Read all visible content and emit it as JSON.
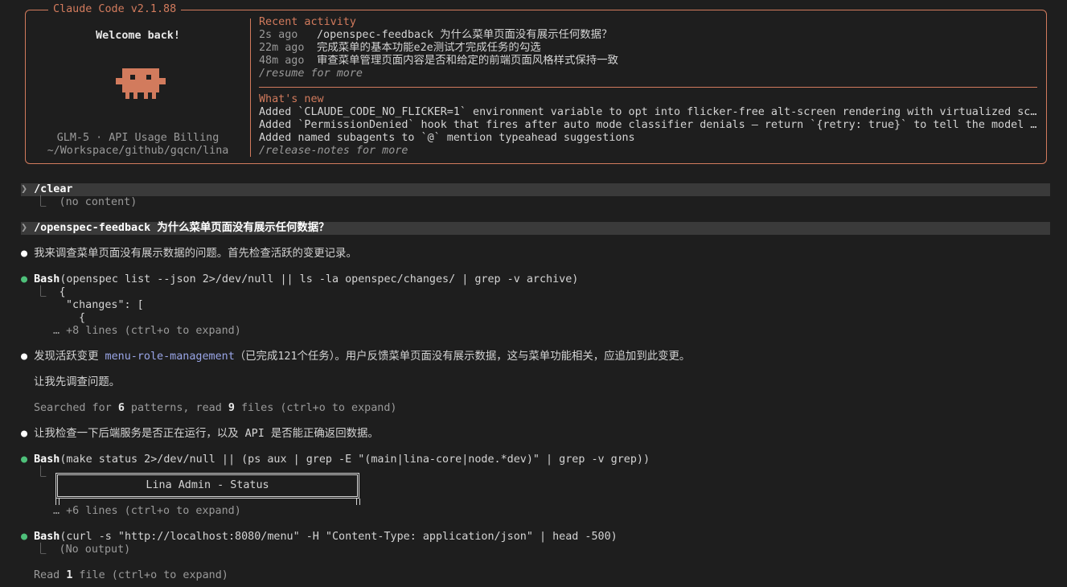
{
  "header": {
    "title": "Claude Code v2.1.88",
    "welcome": "Welcome back!",
    "model_line": "GLM-5 · API Usage Billing",
    "cwd": "~/Workspace/github/gqcn/lina",
    "recent_activity_title": "Recent activity",
    "recent": [
      {
        "time": "2s ago",
        "text": "/openspec-feedback 为什么菜单页面没有展示任何数据？"
      },
      {
        "time": "22m ago",
        "text": "完成菜单的基本功能e2e测试才完成任务的勾选"
      },
      {
        "time": "48m ago",
        "text": "审查菜单管理页面内容是否和给定的前端页面风格样式保持一致"
      }
    ],
    "resume_hint": "/resume for more",
    "whats_new_title": "What's new",
    "whats_new": [
      "Added `CLAUDE_CODE_NO_FLICKER=1` environment variable to opt into flicker-free alt-screen rendering with virtualized scr…",
      "Added `PermissionDenied` hook that fires after auto mode classifier denials — return `{retry: true}` to tell the model i…",
      "Added named subagents to `@` mention typeahead suggestions"
    ],
    "release_hint": "/release-notes for more",
    "accent_color": "#d27b5d"
  },
  "transcript": {
    "p1_cmd": "/clear",
    "p1_out": "(no content)",
    "p2_cmd": "/openspec-feedback 为什么菜单页面没有展示任何数据？",
    "m1": "我来调查菜单页面没有展示数据的问题。首先检查活跃的变更记录。",
    "bash1_tool": "Bash",
    "bash1_args": "(openspec list --json 2>/dev/null || ls -la openspec/changes/ | grep -v archive)",
    "bash1_out1": "{",
    "bash1_out2": "\"changes\": [",
    "bash1_out3": "{",
    "bash1_more": "… +8 lines (ctrl+o to expand)",
    "m2_pre": "发现活跃变更 ",
    "m2_link": "menu-role-management",
    "m2_post": "（已完成121个任务）。用户反馈菜单页面没有展示数据，这与菜单功能相关，应追加到此变更。",
    "m3": "让我先调查问题。",
    "search_pre": "Searched for ",
    "search_n1": "6",
    "search_mid": " patterns, read ",
    "search_n2": "9",
    "search_post": " files (ctrl+o to expand)",
    "m4": "让我检查一下后端服务是否正在运行，以及 API 是否能正确返回数据。",
    "bash2_tool": "Bash",
    "bash2_args": "(make status 2>/dev/null || (ps aux | grep -E \"(main|lina-core|node.*dev)\" | grep -v grep))",
    "status_title": "Lina Admin - Status",
    "bash2_more": "… +6 lines (ctrl+o to expand)",
    "bash3_tool": "Bash",
    "bash3_args": "(curl -s \"http://localhost:8080/menu\" -H \"Content-Type: application/json\" | head -500)",
    "bash3_out": "(No output)",
    "read_pre": "Read ",
    "read_n": "1",
    "read_post": " file (ctrl+o to expand)"
  },
  "glyphs": {
    "prompt": "❯",
    "bullet": "●",
    "elbow": "⎿"
  }
}
